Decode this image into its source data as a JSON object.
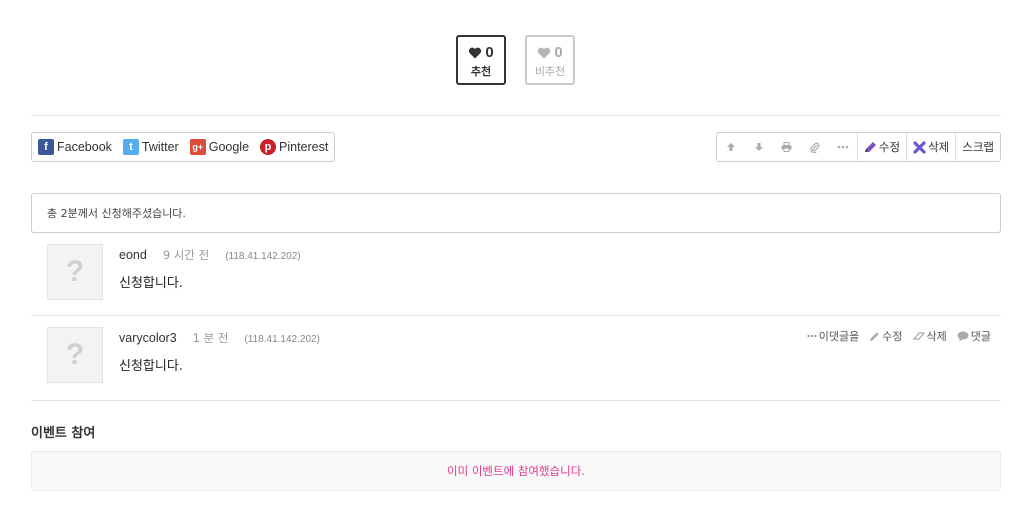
{
  "vote": {
    "recommend": {
      "count": "0",
      "label": "추천"
    },
    "not_recommend": {
      "count": "0",
      "label": "비추천"
    }
  },
  "share": [
    {
      "icon": "facebook-icon",
      "glyph": "f",
      "label": "Facebook"
    },
    {
      "icon": "twitter-icon",
      "glyph": "t",
      "label": "Twitter"
    },
    {
      "icon": "google-plus-icon",
      "glyph": "g+",
      "label": "Google"
    },
    {
      "icon": "pinterest-icon",
      "glyph": "p",
      "label": "Pinterest"
    }
  ],
  "toolbar": {
    "edit_label": "수정",
    "delete_label": "삭제",
    "scrap_label": "스크랩"
  },
  "notice": {
    "text": "총 2분께서 신청해주셨습니다."
  },
  "comments": [
    {
      "author": "eond",
      "time": "9 시간 전",
      "ip": "(118.41.142.202)",
      "text": "신청합니다.",
      "avatar": "?"
    },
    {
      "author": "varycolor3",
      "time": "1 분 전",
      "ip": "(118.41.142.202)",
      "text": "신청합니다.",
      "avatar": "?",
      "actions": {
        "reply_to": "이댓글을",
        "edit": "수정",
        "delete": "삭제",
        "reply": "댓글"
      }
    }
  ],
  "event": {
    "title": "이벤트 참여",
    "message": "이미 이벤트에 참여했습니다."
  },
  "colors": {
    "event_message": "#e4398d",
    "facebook": "#3b5998",
    "twitter": "#55acee",
    "google": "#dd4b39",
    "pinterest": "#cb2027"
  }
}
